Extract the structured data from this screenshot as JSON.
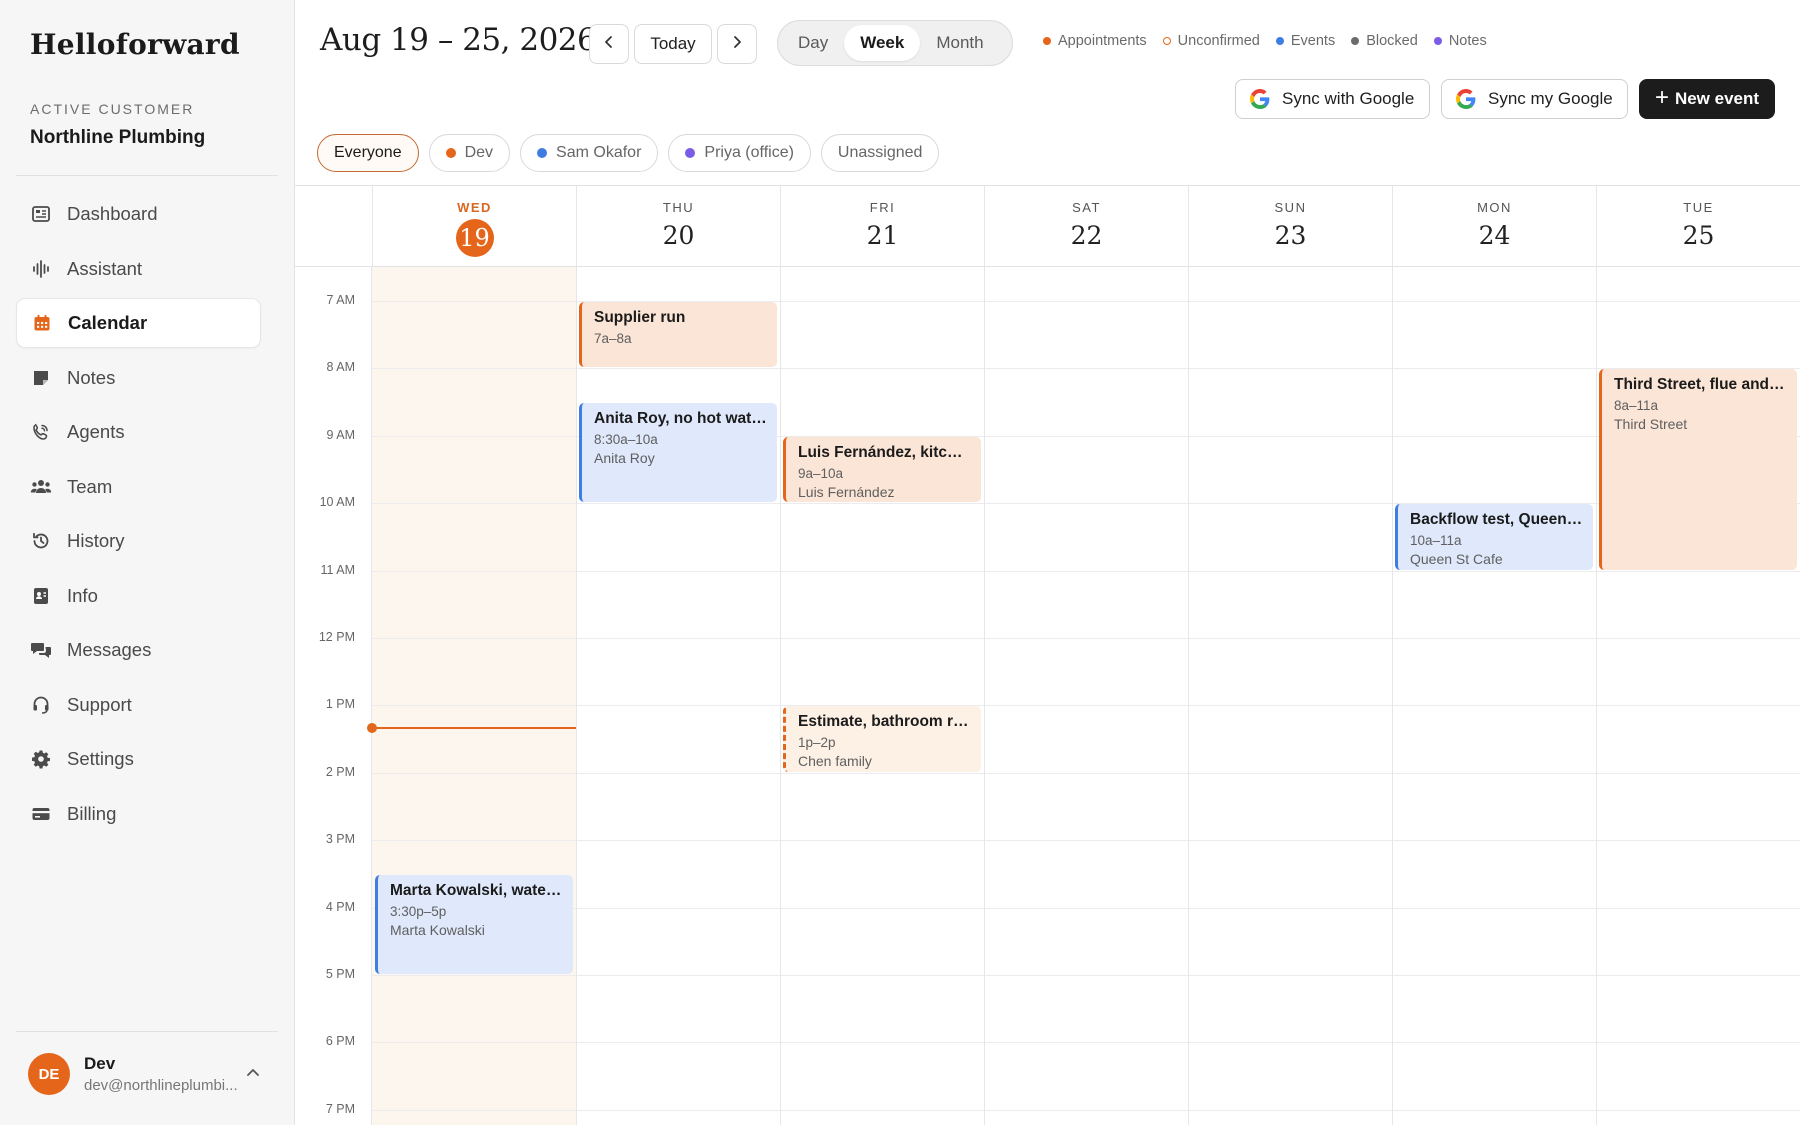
{
  "brand": "Helloforward",
  "customer": {
    "label": "ACTIVE CUSTOMER",
    "name": "Northline Plumbing"
  },
  "nav": [
    {
      "label": "Dashboard",
      "icon": "dashboard-icon"
    },
    {
      "label": "Assistant",
      "icon": "waveform-icon"
    },
    {
      "label": "Calendar",
      "icon": "calendar-icon",
      "active": true
    },
    {
      "label": "Notes",
      "icon": "note-icon"
    },
    {
      "label": "Agents",
      "icon": "phone-icon"
    },
    {
      "label": "Team",
      "icon": "team-icon"
    },
    {
      "label": "History",
      "icon": "history-icon"
    },
    {
      "label": "Info",
      "icon": "info-card-icon"
    },
    {
      "label": "Messages",
      "icon": "messages-icon"
    },
    {
      "label": "Support",
      "icon": "headset-icon"
    },
    {
      "label": "Settings",
      "icon": "gear-icon"
    },
    {
      "label": "Billing",
      "icon": "card-icon"
    }
  ],
  "user": {
    "initials": "DE",
    "name": "Dev",
    "email": "dev@northlineplumbi..."
  },
  "header": {
    "date_range": "Aug 19 – 25, 2026",
    "today_label": "Today",
    "views": [
      "Day",
      "Week",
      "Month"
    ],
    "active_view": "Week",
    "legend": [
      {
        "label": "Appointments",
        "color": "#e5661a",
        "hollow": false
      },
      {
        "label": "Unconfirmed",
        "color": "#e5661a",
        "hollow": true
      },
      {
        "label": "Events",
        "color": "#3f7ee0",
        "hollow": false
      },
      {
        "label": "Blocked",
        "color": "#6b6b6b",
        "hollow": false
      },
      {
        "label": "Notes",
        "color": "#7a5ce6",
        "hollow": false
      }
    ],
    "sync_with_google": "Sync with Google",
    "sync_my_google": "Sync my Google",
    "new_event": "New event"
  },
  "filters": [
    {
      "label": "Everyone",
      "active": true
    },
    {
      "label": "Dev",
      "color": "#e5661a"
    },
    {
      "label": "Sam Okafor",
      "color": "#3f7ee0"
    },
    {
      "label": "Priya (office)",
      "color": "#7a5ce6"
    },
    {
      "label": "Unassigned"
    }
  ],
  "days": [
    {
      "dow": "WED",
      "num": "19",
      "today": true
    },
    {
      "dow": "THU",
      "num": "20"
    },
    {
      "dow": "FRI",
      "num": "21"
    },
    {
      "dow": "SAT",
      "num": "22"
    },
    {
      "dow": "SUN",
      "num": "23"
    },
    {
      "dow": "MON",
      "num": "24"
    },
    {
      "dow": "TUE",
      "num": "25"
    }
  ],
  "hours": [
    "7 AM",
    "8 AM",
    "9 AM",
    "10 AM",
    "11 AM",
    "12 PM",
    "1 PM",
    "2 PM",
    "3 PM",
    "4 PM",
    "5 PM",
    "6 PM",
    "7 PM"
  ],
  "now_time": 13.33,
  "events": [
    {
      "day": 1,
      "start": 7,
      "end": 8,
      "title": "Supplier run",
      "time": "7a–8a",
      "kind": "appt"
    },
    {
      "day": 1,
      "start": 8.5,
      "end": 10,
      "title": "Anita Roy, no hot wat…",
      "time": "8:30a–10a",
      "who": "Anita Roy",
      "kind": "event"
    },
    {
      "day": 2,
      "start": 9,
      "end": 10,
      "title": "Luis Fernández, kitch…",
      "time": "9a–10a",
      "who": "Luis Fernández",
      "kind": "appt"
    },
    {
      "day": 2,
      "start": 13,
      "end": 14,
      "title": "Estimate, bathroom r…",
      "time": "1p–2p",
      "who": "Chen family",
      "kind": "unconf"
    },
    {
      "day": 5,
      "start": 10,
      "end": 11,
      "title": "Backflow test, Queen …",
      "time": "10a–11a",
      "who": "Queen St Cafe",
      "kind": "event"
    },
    {
      "day": 6,
      "start": 8,
      "end": 11,
      "title": "Third Street, flue and …",
      "time": "8a–11a",
      "who": "Third Street",
      "kind": "appt"
    },
    {
      "day": 0,
      "start": 15.5,
      "end": 17,
      "title": "Marta Kowalski, wate…",
      "time": "3:30p–5p",
      "who": "Marta Kowalski",
      "kind": "event"
    }
  ]
}
